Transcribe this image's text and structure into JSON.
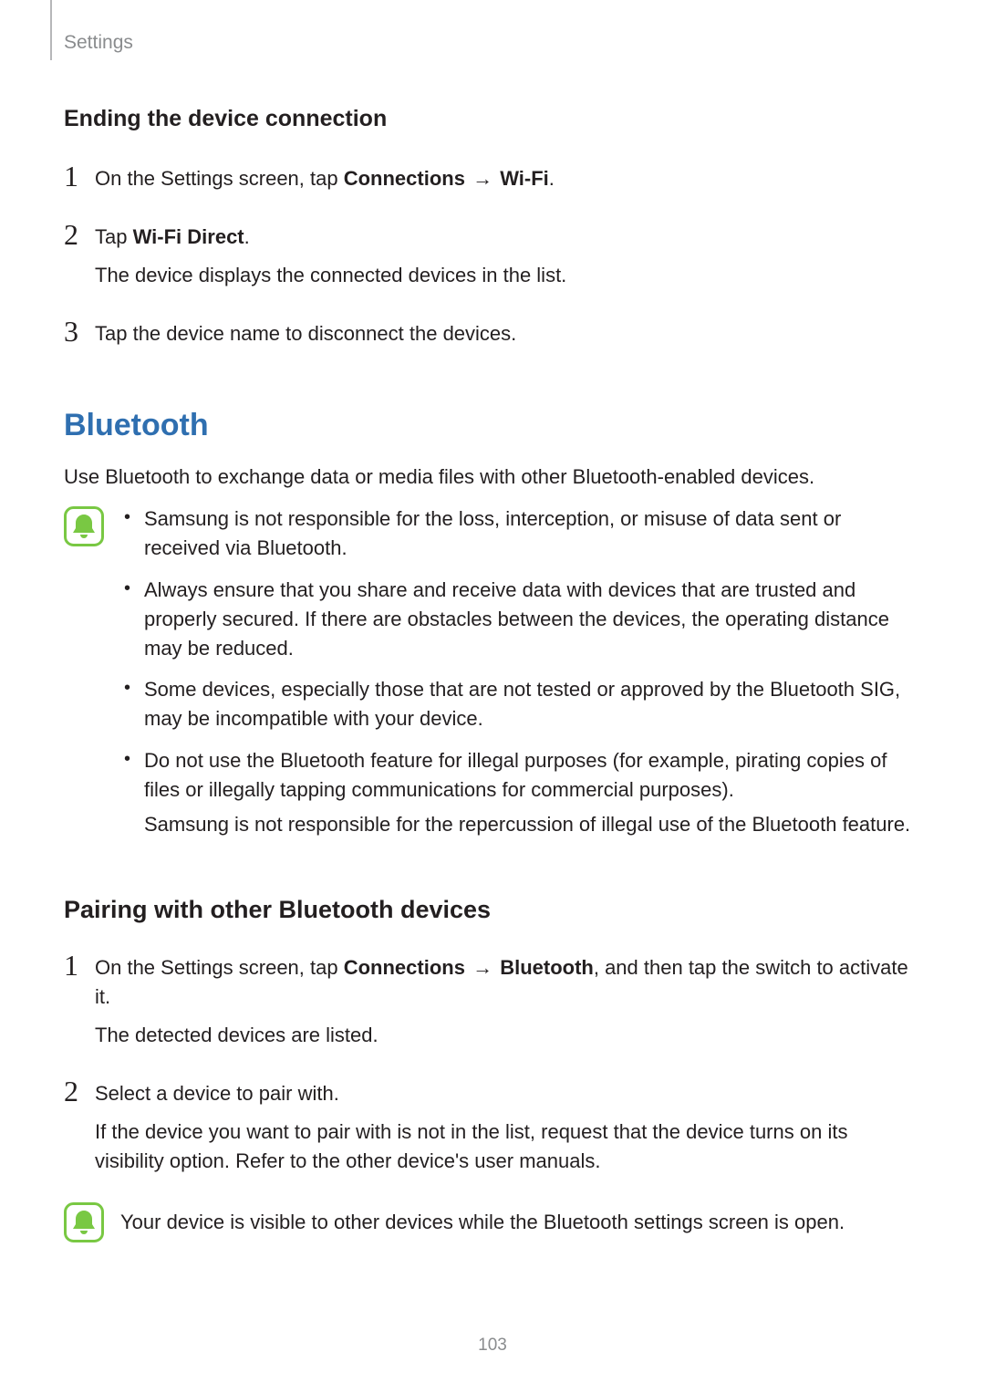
{
  "header": {
    "section": "Settings"
  },
  "ending": {
    "title": "Ending the device connection",
    "steps": [
      {
        "num": "1",
        "line_pre": "On the Settings screen, tap ",
        "bold1": "Connections",
        "arrow": " → ",
        "bold2": "Wi-Fi",
        "line_post": "."
      },
      {
        "num": "2",
        "line_pre": "Tap ",
        "bold1": "Wi-Fi Direct",
        "line_post": ".",
        "extra": "The device displays the connected devices in the list."
      },
      {
        "num": "3",
        "line": "Tap the device name to disconnect the devices."
      }
    ]
  },
  "bluetooth": {
    "title": "Bluetooth",
    "intro": "Use Bluetooth to exchange data or media files with other Bluetooth-enabled devices.",
    "notes": [
      {
        "text": "Samsung is not responsible for the loss, interception, or misuse of data sent or received via Bluetooth."
      },
      {
        "text": "Always ensure that you share and receive data with devices that are trusted and properly secured. If there are obstacles between the devices, the operating distance may be reduced."
      },
      {
        "text": "Some devices, especially those that are not tested or approved by the Bluetooth SIG, may be incompatible with your device."
      },
      {
        "text": "Do not use the Bluetooth feature for illegal purposes (for example, pirating copies of files or illegally tapping communications for commercial purposes).",
        "sub": "Samsung is not responsible for the repercussion of illegal use of the Bluetooth feature."
      }
    ]
  },
  "pairing": {
    "title": "Pairing with other Bluetooth devices",
    "steps": [
      {
        "num": "1",
        "line_pre": "On the Settings screen, tap ",
        "bold1": "Connections",
        "arrow": " → ",
        "bold2": "Bluetooth",
        "line_post": ", and then tap the switch to activate it.",
        "extra": "The detected devices are listed."
      },
      {
        "num": "2",
        "line": "Select a device to pair with.",
        "extra": "If the device you want to pair with is not in the list, request that the device turns on its visibility option. Refer to the other device's user manuals."
      }
    ],
    "note": "Your device is visible to other devices while the Bluetooth settings screen is open."
  },
  "page_number": "103"
}
